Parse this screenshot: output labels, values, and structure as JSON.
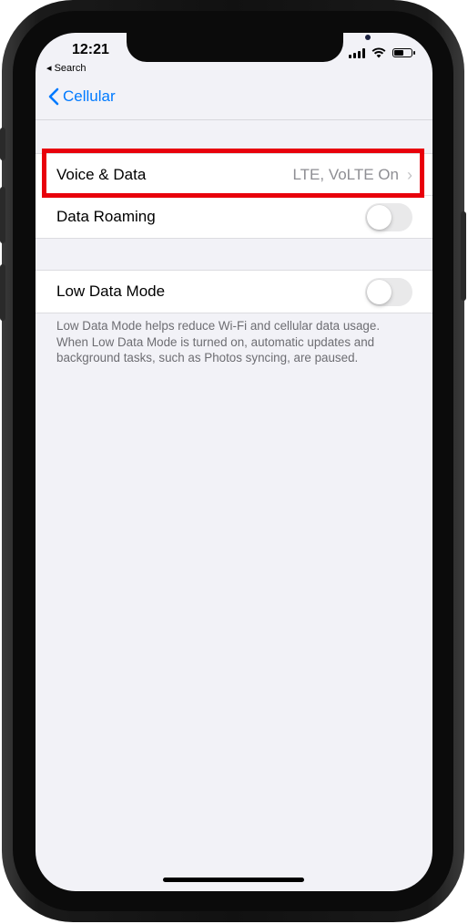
{
  "status_bar": {
    "time": "12:21",
    "back_link": "◂ Search",
    "battery_level": 0.6
  },
  "nav": {
    "back_label": "Cellular",
    "back_icon": "chevron-left-icon",
    "accent_color": "#007aff"
  },
  "cellular_options": {
    "voice_data_label": "Voice & Data",
    "voice_data_value": "LTE, VoLTE On",
    "data_roaming_label": "Data Roaming",
    "data_roaming_on": false
  },
  "low_data": {
    "label": "Low Data Mode",
    "on": false,
    "footnote": "Low Data Mode helps reduce Wi-Fi and cellular data usage. When Low Data Mode is turned on, automatic updates and background tasks, such as Photos syncing, are paused."
  },
  "highlight_color": "#e8000b"
}
